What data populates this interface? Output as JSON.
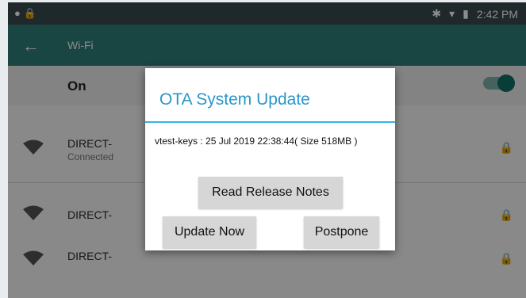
{
  "statusbar": {
    "time": "2:42 PM",
    "icons": [
      "circle-icon",
      "lock-icon",
      "bluetooth-icon",
      "wifi-icon",
      "battery-icon"
    ]
  },
  "appbar": {
    "title": "Wi-Fi",
    "back_icon": "back-arrow-icon"
  },
  "wifi_switch": {
    "label": "On",
    "state": "on"
  },
  "networks": [
    {
      "name": "DIRECT-",
      "status": "Connected",
      "secured": true
    },
    {
      "name": "DIRECT-",
      "status": "",
      "secured": true
    },
    {
      "name": "DIRECT-",
      "status": "",
      "secured": true
    }
  ],
  "dialog": {
    "title": "OTA System Update",
    "message": "vtest-keys : 25 Jul 2019 22:38:44( Size 518MB )",
    "buttons": {
      "release_notes": "Read Release Notes",
      "update_now": "Update Now",
      "postpone": "Postpone"
    }
  },
  "colors": {
    "appbar": "#2f7f78",
    "accent": "#33b5e5",
    "title_text": "#2a96c8"
  }
}
